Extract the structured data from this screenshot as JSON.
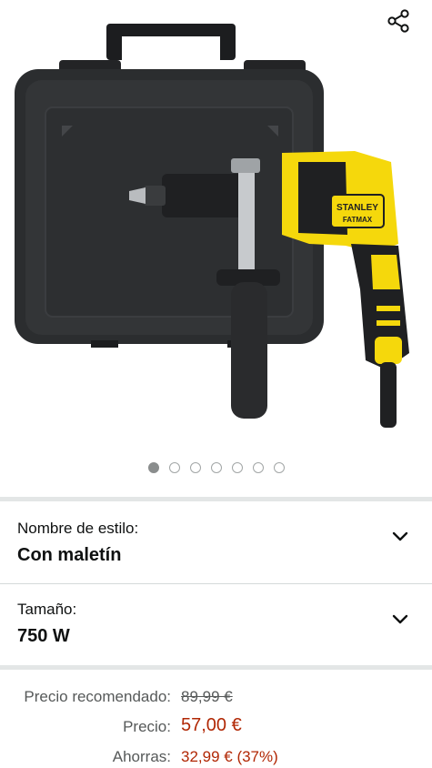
{
  "gallery": {
    "share_icon": "share-icon",
    "image_count": 7,
    "active_index": 0,
    "brand_text": "STANLEY",
    "sub_brand_text": "FATMAX"
  },
  "style_option": {
    "label": "Nombre de estilo:",
    "value": "Con maletín",
    "icon": "chevron-down-icon"
  },
  "size_option": {
    "label": "Tamaño:",
    "value": "750 W",
    "icon": "chevron-down-icon"
  },
  "pricing": {
    "list_price_label": "Precio recomendado:",
    "list_price": "89,99 €",
    "price_label": "Precio:",
    "price": "57,00 €",
    "savings_label": "Ahorras:",
    "savings": "32,99 € (37%)"
  },
  "colors": {
    "price_red": "#b12704",
    "drill_yellow": "#f5d80c",
    "case_black": "#2b2d2f"
  }
}
